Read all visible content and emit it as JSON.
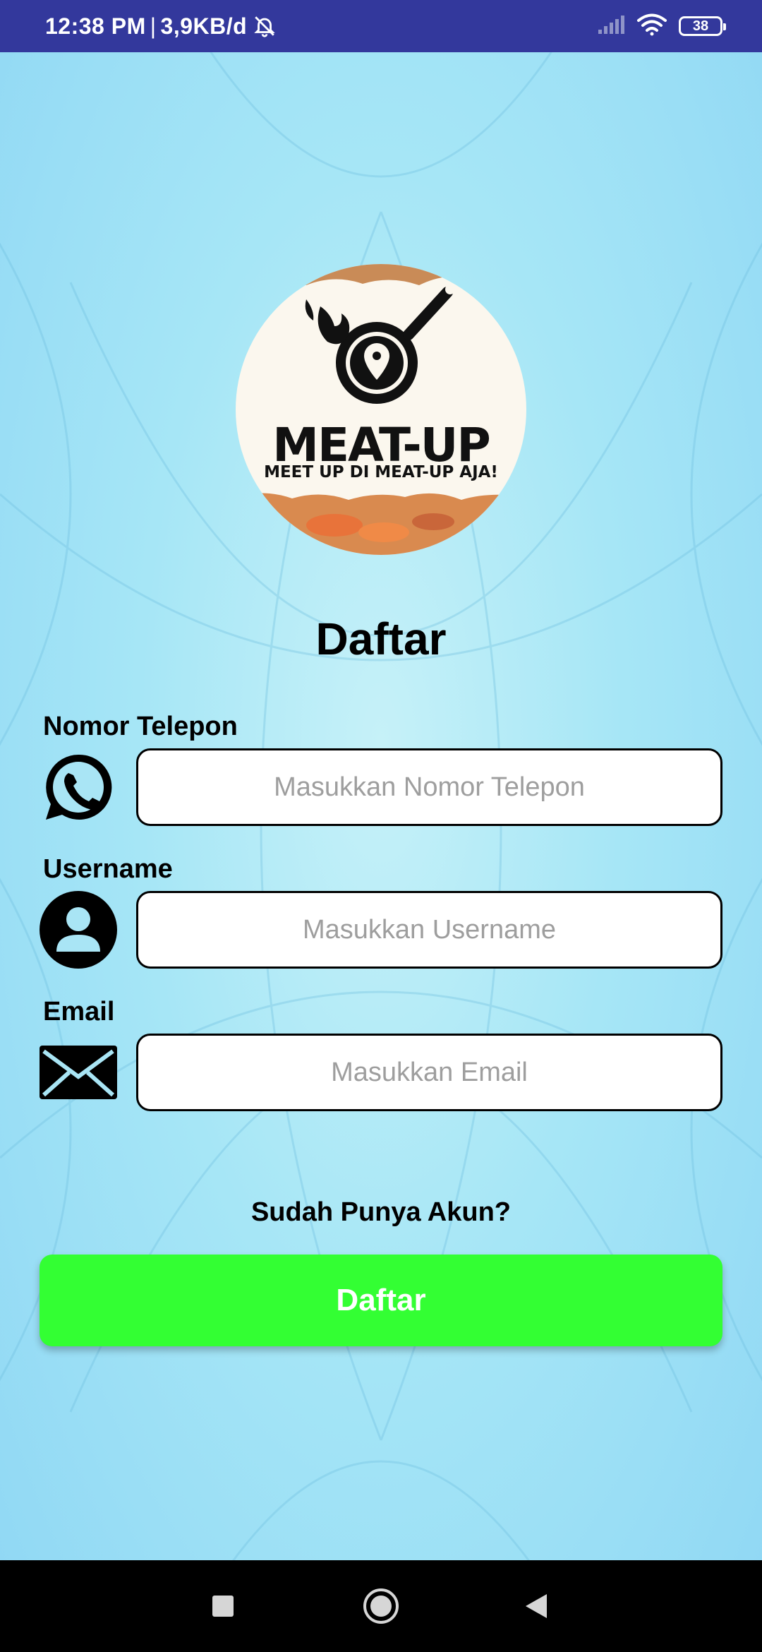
{
  "status_bar": {
    "time": "12:38 PM",
    "separator": "|",
    "network_speed": "3,9KB/d",
    "battery_level": "38",
    "icons": [
      "alarm-off-icon",
      "signal-icon",
      "wifi-icon",
      "battery-icon"
    ]
  },
  "logo": {
    "wordmark": "MEAT-UP",
    "tagline": "MEET UP DI MEAT-UP AJA!",
    "icon": "skillet-location-pin-icon"
  },
  "page": {
    "title": "Daftar"
  },
  "form": {
    "phone": {
      "label": "Nomor Telepon",
      "placeholder": "Masukkan Nomor Telepon",
      "value": "",
      "icon": "whatsapp-icon"
    },
    "username": {
      "label": "Username",
      "placeholder": "Masukkan Username",
      "value": "",
      "icon": "user-icon"
    },
    "email": {
      "label": "Email",
      "placeholder": "Masukkan Email",
      "value": "",
      "icon": "mail-icon"
    }
  },
  "login_link": "Sudah Punya Akun?",
  "submit_button": "Daftar",
  "colors": {
    "status_bar": "#33389c",
    "background": "#a6e6f6",
    "button": "#33ff33",
    "button_text": "#ffffff",
    "nav_bar": "#000000"
  },
  "nav_bar": {
    "icons": [
      "recent-apps-icon",
      "home-icon",
      "back-icon"
    ]
  }
}
